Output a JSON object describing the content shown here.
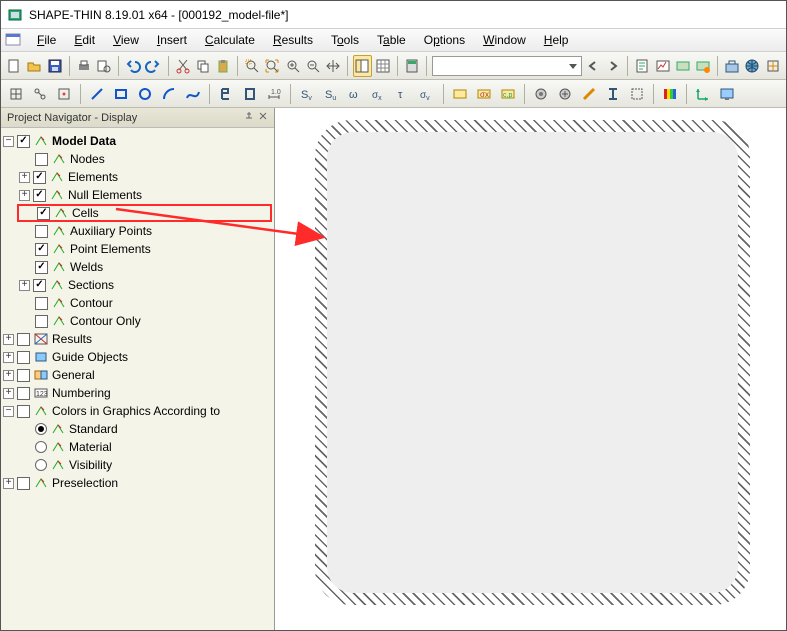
{
  "title": "SHAPE-THIN 8.19.01 x64 - [000192_model-file*]",
  "menu": [
    "File",
    "Edit",
    "View",
    "Insert",
    "Calculate",
    "Results",
    "Tools",
    "Table",
    "Options",
    "Window",
    "Help"
  ],
  "nav": {
    "header": "Project Navigator - Display",
    "modelData": "Model Data",
    "items": {
      "nodes": "Nodes",
      "elements": "Elements",
      "nullElements": "Null Elements",
      "cells": "Cells",
      "auxPoints": "Auxiliary Points",
      "pointElements": "Point Elements",
      "welds": "Welds",
      "sections": "Sections",
      "contour": "Contour",
      "contourOnly": "Contour Only"
    },
    "results": "Results",
    "guideObjects": "Guide Objects",
    "general": "General",
    "numbering": "Numbering",
    "colors": "Colors in Graphics According to",
    "colorOpts": {
      "standard": "Standard",
      "material": "Material",
      "visibility": "Visibility"
    },
    "preselection": "Preselection"
  }
}
